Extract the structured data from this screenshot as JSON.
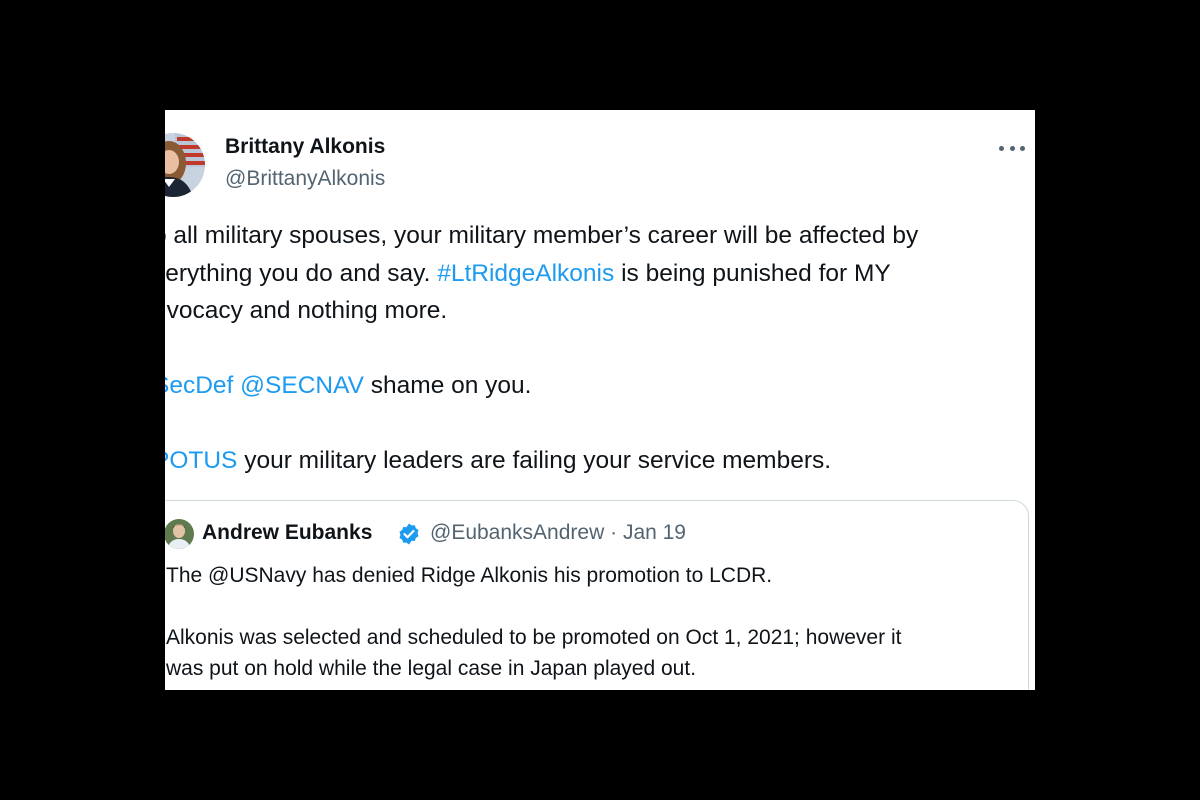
{
  "tweet": {
    "author": {
      "name": "Brittany Alkonis",
      "handle": "@BrittanyAlkonis",
      "avatar_icon": "profile-photo-avatar"
    },
    "more_icon": "more-horizontal-icon",
    "body": {
      "line1": "o all military spouses, your military member’s career will be affected by",
      "line2_pre": "verything you do and say.",
      "line2_hashtag": "#LtRidgeAlkonis",
      "line2_post": "is being punished for MY",
      "line3": "dvocacy and nothing more.",
      "line4_mention1": "SecDef",
      "line4_mention2": "@SECNAV",
      "line4_post": "shame on you.",
      "line5_mention": "POTUS",
      "line5_post": "your military leaders are failing your service members."
    },
    "quote": {
      "author_name": "Andrew Eubanks",
      "verified_icon": "verified-badge-icon",
      "handle": "@EubanksAndrew",
      "separator": "·",
      "date": "Jan 19",
      "line1_pre": "The",
      "line1_mention": "@USNavy",
      "line1_post": "has denied Ridge Alkonis his promotion to LCDR.",
      "line2": "Alkonis was selected and scheduled to be promoted on Oct 1, 2021; however it",
      "line3": "was put on hold while the legal case in Japan played out."
    }
  },
  "colors": {
    "background": "#000000",
    "card": "#ffffff",
    "text": "#0f1419",
    "secondary_text": "#536471",
    "link": "#1d9bf0",
    "border": "#cfd9de"
  }
}
